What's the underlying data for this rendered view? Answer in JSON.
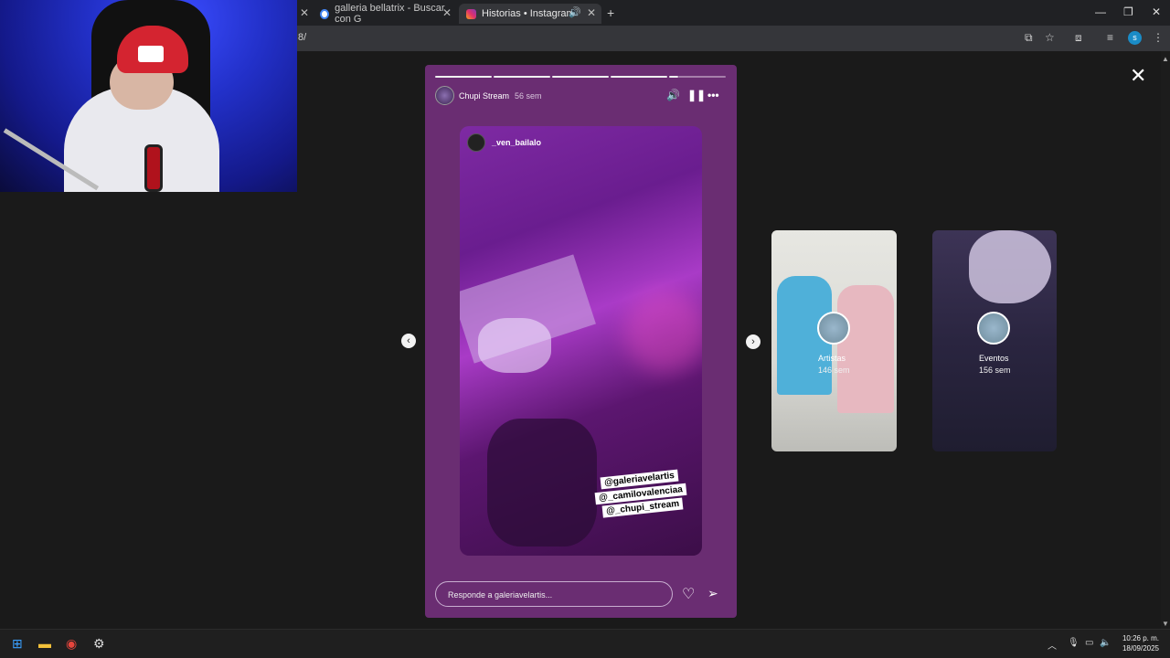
{
  "browser": {
    "tabs": [
      {
        "label": "galleria bellatrix - Buscar con G",
        "active": false
      },
      {
        "label": "Historias • Instagram",
        "active": true
      }
    ],
    "url_fragment": "8/",
    "profile_initial": "s"
  },
  "story": {
    "username": "Chupi Stream",
    "time": "56 sem",
    "media_username": "_ven_bailalo",
    "tags": [
      "@galeriavelartis",
      "@_camilovalenciaa",
      "@_chupi_stream"
    ],
    "reply_placeholder": "Responde a galeriavelartis..."
  },
  "previews": [
    {
      "name": "Artistas",
      "time": "146 sem"
    },
    {
      "name": "Eventos",
      "time": "156 sem"
    }
  ],
  "taskbar": {
    "time": "10:26 p. m.",
    "date": "18/09/2025"
  },
  "icons": [
    "windows-start-icon",
    "file-explorer-icon",
    "chrome-icon",
    "app-icon",
    "speaker-icon",
    "pause-icon",
    "more-icon",
    "heart-icon",
    "send-icon",
    "close-icon"
  ]
}
